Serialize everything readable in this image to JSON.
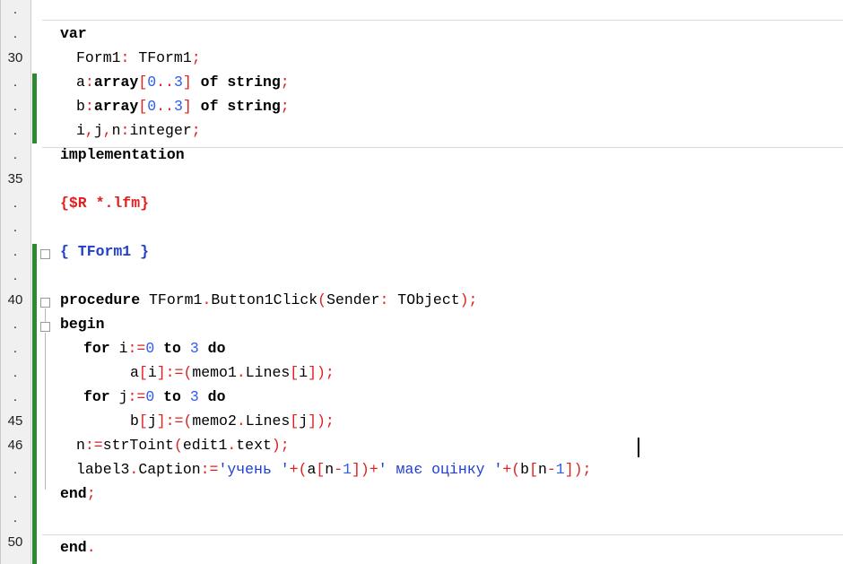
{
  "gutter": {
    "labels": [
      ".",
      ".",
      "30",
      ".",
      ".",
      ".",
      ".",
      "35",
      ".",
      ".",
      ".",
      ".",
      "40",
      ".",
      ".",
      ".",
      ".",
      "45",
      "46",
      ".",
      ".",
      ".",
      "50"
    ]
  },
  "code": {
    "l1": {
      "t1": "var"
    },
    "l2": {
      "t1": "Form1",
      "t2": ":",
      "t3": " TForm1",
      "t4": ";"
    },
    "l3": {
      "t1": "a",
      "t2": ":",
      "t3": "array",
      "t4": "[",
      "t5": "0",
      "t6": "..",
      "t7": "3",
      "t8": "]",
      "t9": " of ",
      "t10": "string",
      "t11": ";"
    },
    "l4": {
      "t1": "b",
      "t2": ":",
      "t3": "array",
      "t4": "[",
      "t5": "0",
      "t6": "..",
      "t7": "3",
      "t8": "]",
      "t9": " of ",
      "t10": "string",
      "t11": ";"
    },
    "l5": {
      "t1": "i",
      "t2": ",",
      "t3": "j",
      "t4": ",",
      "t5": "n",
      "t6": ":",
      "t7": "integer",
      "t8": ";"
    },
    "l6": {
      "t1": "implementation"
    },
    "l7": {
      "t1": "{$R *.lfm}"
    },
    "l8": {
      "t1": "{ TForm1 }"
    },
    "l9": {
      "t1": "procedure",
      "t2": " TForm1",
      "t3": ".",
      "t4": "Button1Click",
      "t5": "(",
      "t6": "Sender",
      "t7": ":",
      "t8": " TObject",
      "t9": ")",
      "t10": ";"
    },
    "l10": {
      "t1": "begin"
    },
    "l11": {
      "t1": "for",
      "t2": " i",
      "t3": ":=",
      "t4": "0",
      "t5": " to ",
      "t6": "3",
      "t7": " do"
    },
    "l12": {
      "t1": "a",
      "t2": "[",
      "t3": "i",
      "t4": "]",
      "t5": ":=",
      "t6": "(",
      "t7": "memo1",
      "t8": ".",
      "t9": "Lines",
      "t10": "[",
      "t11": "i",
      "t12": "])",
      "t13": ";"
    },
    "l13": {
      "t1": "for",
      "t2": " j",
      "t3": ":=",
      "t4": "0",
      "t5": " to ",
      "t6": "3",
      "t7": " do"
    },
    "l14": {
      "t1": "b",
      "t2": "[",
      "t3": "j",
      "t4": "]",
      "t5": ":=",
      "t6": "(",
      "t7": "memo2",
      "t8": ".",
      "t9": "Lines",
      "t10": "[",
      "t11": "j",
      "t12": "])",
      "t13": ";"
    },
    "l15": {
      "t1": "n",
      "t2": ":=",
      "t3": "strToint",
      "t4": "(",
      "t5": "edit1",
      "t6": ".",
      "t7": "text",
      "t8": ")",
      "t9": ";"
    },
    "l16": {
      "t1": "label3",
      "t2": ".",
      "t3": "Caption",
      "t4": ":=",
      "t5": "'учень '",
      "t6": "+(",
      "t7": "a",
      "t8": "[",
      "t9": "n",
      "t10": "-",
      "t11": "1",
      "t12": "])+",
      "t13": "' має оцінку '",
      "t14": "+(",
      "t15": "b",
      "t16": "[",
      "t17": "n",
      "t18": "-",
      "t19": "1",
      "t20": "]);"
    },
    "l17": {
      "t1": "end",
      "t2": ";"
    },
    "l18": {
      "t1": "end",
      "t2": "."
    }
  },
  "colors": {
    "symbol": "#e02020",
    "number": "#2c5cf0",
    "string": "#1f3fd0",
    "change-bar": "#2f8a2f"
  }
}
